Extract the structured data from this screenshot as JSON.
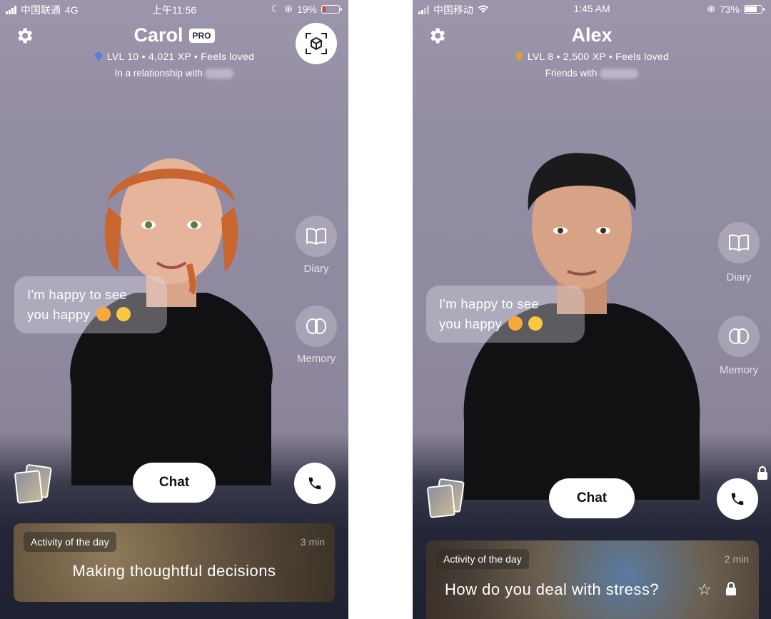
{
  "left": {
    "status": {
      "carrier": "中国联通",
      "network": "4G",
      "time": "上午11:56",
      "battery": "19%"
    },
    "name": "Carol",
    "badge": "PRO",
    "stats": "LVL 10 • 4,021 XP • Feels loved",
    "relationship": "In a relationship with",
    "diary_label": "Diary",
    "memory_label": "Memory",
    "bubble_line1": "I'm happy to see",
    "bubble_line2": "you happy",
    "chat_label": "Chat",
    "activity": {
      "tag": "Activity of the day",
      "duration": "3 min",
      "title": "Making thoughtful decisions"
    }
  },
  "right": {
    "status": {
      "carrier": "中国移动",
      "time": "1:45 AM",
      "battery": "73%"
    },
    "name": "Alex",
    "stats": "LVL 8 • 2,500 XP • Feels loved",
    "relationship": "Friends with",
    "diary_label": "Diary",
    "memory_label": "Memory",
    "bubble_line1": "I'm happy to see",
    "bubble_line2": "you happy",
    "chat_label": "Chat",
    "activity": {
      "tag": "Activity of the day",
      "duration": "2 min",
      "title": "How do you deal with stress?"
    }
  },
  "colors": {
    "battery_low": "#e0473c",
    "battery_ok": "#ffffff",
    "gem_left": "#5a7bd6",
    "gem_right": "#d6a33a"
  }
}
